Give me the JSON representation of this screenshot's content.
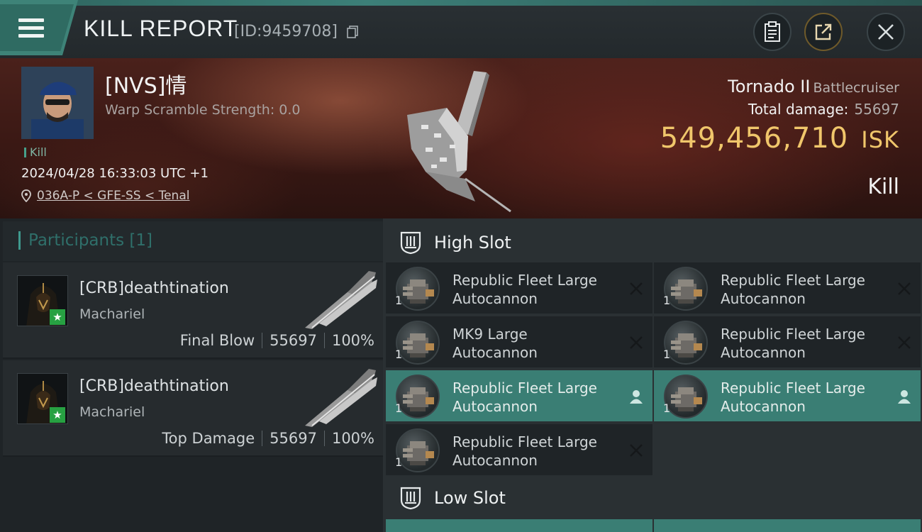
{
  "header": {
    "title": "KILL REPORT",
    "report_id": "[ID:9459708]",
    "icons": [
      "menu-icon",
      "copy-icon",
      "clipboard-icon",
      "share-icon",
      "close-icon"
    ]
  },
  "victim": {
    "pilot": "[NVS]情",
    "warp_scramble": "Warp Scramble Strength: 0.0",
    "kill_tag": "Kill",
    "datetime": "2024/04/28 16:33:03 UTC +1",
    "location": "036A-P < GFE-SS < Tenal",
    "ship_name": "Tornado II",
    "ship_class": "Battlecruiser",
    "total_damage_label": "Total damage:",
    "total_damage": "55697",
    "isk_value": "549,456,710",
    "isk_unit": "ISK",
    "result": "Kill"
  },
  "participants": {
    "title": "Participants",
    "count": "[1]",
    "rows": [
      {
        "name": "[CRB]deathtination",
        "ship": "Machariel",
        "role": "Final Blow",
        "damage": "55697",
        "percent": "100%"
      },
      {
        "name": "[CRB]deathtination",
        "ship": "Machariel",
        "role": "Top Damage",
        "damage": "55697",
        "percent": "100%"
      }
    ]
  },
  "slots": {
    "high_title": "High Slot",
    "low_title": "Low Slot",
    "high_items": [
      {
        "line1": "Republic Fleet Large",
        "line2": "Autocannon",
        "qty": "1",
        "status": "destroyed"
      },
      {
        "line1": "Republic Fleet Large",
        "line2": "Autocannon",
        "qty": "1",
        "status": "destroyed"
      },
      {
        "line1": "MK9 Large",
        "line2": "Autocannon",
        "qty": "1",
        "status": "destroyed"
      },
      {
        "line1": "Republic Fleet Large",
        "line2": "Autocannon",
        "qty": "1",
        "status": "destroyed"
      },
      {
        "line1": "Republic Fleet Large",
        "line2": "Autocannon",
        "qty": "1",
        "status": "dropped"
      },
      {
        "line1": "Republic Fleet Large",
        "line2": "Autocannon",
        "qty": "1",
        "status": "dropped"
      },
      {
        "line1": "Republic Fleet Large",
        "line2": "Autocannon",
        "qty": "1",
        "status": "destroyed"
      }
    ]
  },
  "colors": {
    "accent": "#3a7e74",
    "isk": "#f0c66b",
    "header_tab": "#2f6b62"
  }
}
